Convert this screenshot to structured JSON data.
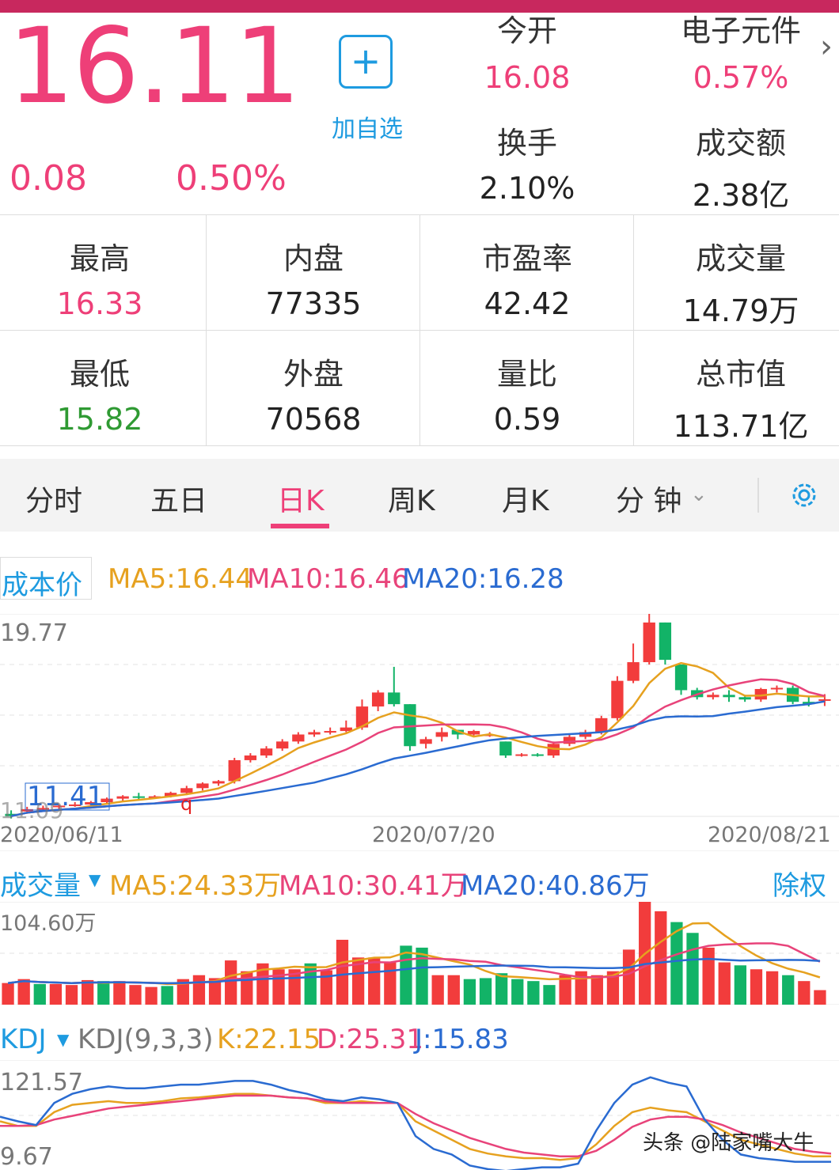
{
  "quote": {
    "price": "16.11",
    "change": "0.08",
    "change_pct": "0.50%",
    "add_label": "加自选",
    "add_icon": "plus-icon"
  },
  "top_stats": [
    {
      "label": "今开",
      "value": "16.08"
    },
    {
      "label": "电子元件",
      "value": "0.57%"
    },
    {
      "label": "换手",
      "value": "2.10%"
    },
    {
      "label": "成交额",
      "value": "2.38亿"
    }
  ],
  "stats_grid": [
    {
      "label": "最高",
      "value": "16.33"
    },
    {
      "label": "内盘",
      "value": "77335"
    },
    {
      "label": "市盈率",
      "value": "42.42"
    },
    {
      "label": "成交量",
      "value": "14.79万"
    },
    {
      "label": "最低",
      "value": "15.82"
    },
    {
      "label": "外盘",
      "value": "70568"
    },
    {
      "label": "量比",
      "value": "0.59"
    },
    {
      "label": "总市值",
      "value": "113.71亿"
    }
  ],
  "tabs": [
    "分时",
    "五日",
    "日K",
    "周K",
    "月K",
    "分 钟"
  ],
  "active_tab": "日K",
  "colors": {
    "up": "#f23c3c",
    "down": "#12b367",
    "ma5": "#e6a11f",
    "ma10": "#e8437a",
    "ma20": "#2a6bd1",
    "accent": "#ee3f78"
  },
  "kline": {
    "cost_btn": "成本价",
    "ma5": "MA5:16.44",
    "ma10": "MA10:16.46",
    "ma20": "MA20:16.28",
    "ymax_label": "19.77",
    "low_marker": "11.41",
    "low_marker_partial": "11.09",
    "q_marker": "q",
    "dates": [
      "2020/06/11",
      "2020/07/20",
      "2020/08/21"
    ]
  },
  "volume": {
    "title": "成交量",
    "ma5": "MA5:24.33万",
    "ma10": "MA10:30.41万",
    "ma20": "MA20:40.86万",
    "right_btn": "除权",
    "ymax_label": "104.60万"
  },
  "kdj": {
    "title": "KDJ",
    "params": "KDJ(9,3,3)",
    "k": "K:22.15",
    "d": "D:25.31",
    "j": "J:15.83",
    "ymax_label": "121.57",
    "ymin_label": "9.67"
  },
  "watermark": "头条 @陆家嘴大牛",
  "chart_data": [
    {
      "type": "candlestick",
      "title": "日K",
      "x": [
        "2020/06/11",
        "2020/07/20",
        "2020/08/21"
      ],
      "ohlc": [
        [
          11.2,
          11.35,
          11.1,
          11.0
        ],
        [
          11.3,
          11.5,
          11.4,
          11.2
        ],
        [
          11.4,
          11.55,
          11.45,
          11.3
        ],
        [
          11.5,
          11.6,
          11.55,
          11.4
        ],
        [
          11.55,
          11.7,
          11.6,
          11.5
        ],
        [
          11.6,
          11.75,
          11.7,
          11.5
        ],
        [
          11.7,
          11.9,
          11.85,
          11.6
        ],
        [
          11.85,
          12.0,
          11.95,
          11.75
        ],
        [
          11.95,
          12.1,
          11.9,
          11.8
        ],
        [
          11.9,
          12.0,
          11.95,
          11.85
        ],
        [
          11.95,
          12.15,
          12.1,
          11.9
        ],
        [
          12.1,
          12.4,
          12.3,
          12.0
        ],
        [
          12.3,
          12.55,
          12.5,
          12.2
        ],
        [
          12.5,
          12.65,
          12.6,
          12.4
        ],
        [
          12.6,
          13.6,
          13.5,
          12.5
        ],
        [
          13.5,
          13.8,
          13.7,
          13.4
        ],
        [
          13.7,
          14.1,
          14.0,
          13.6
        ],
        [
          14.0,
          14.4,
          14.3,
          13.9
        ],
        [
          14.3,
          14.7,
          14.6,
          14.2
        ],
        [
          14.6,
          14.8,
          14.7,
          14.5
        ],
        [
          14.7,
          14.9,
          14.75,
          14.6
        ],
        [
          14.75,
          15.2,
          14.9,
          14.7
        ],
        [
          14.9,
          16.1,
          15.8,
          14.8
        ],
        [
          15.8,
          16.5,
          16.4,
          15.6
        ],
        [
          16.4,
          17.5,
          15.9,
          15.8
        ],
        [
          15.9,
          15.0,
          14.1,
          13.9
        ],
        [
          14.2,
          14.5,
          14.4,
          14.0
        ],
        [
          14.5,
          14.9,
          14.7,
          14.3
        ],
        [
          14.8,
          14.5,
          14.6,
          14.4
        ],
        [
          14.6,
          14.8,
          14.75,
          14.5
        ],
        [
          14.6,
          14.7,
          14.6,
          14.5
        ],
        [
          14.3,
          14.2,
          13.7,
          13.6
        ],
        [
          13.7,
          13.8,
          13.75,
          13.65
        ],
        [
          13.75,
          13.8,
          13.7,
          13.65
        ],
        [
          13.7,
          14.3,
          14.2,
          13.6
        ],
        [
          14.2,
          14.6,
          14.5,
          14.1
        ],
        [
          14.5,
          14.8,
          14.7,
          14.4
        ],
        [
          14.7,
          15.4,
          15.3,
          14.6
        ],
        [
          15.3,
          17.1,
          16.9,
          15.2
        ],
        [
          16.9,
          18.5,
          17.7,
          16.8
        ],
        [
          17.7,
          19.77,
          19.4,
          17.6
        ],
        [
          19.4,
          18.9,
          17.8,
          17.6
        ],
        [
          17.6,
          17.2,
          16.5,
          16.3
        ],
        [
          16.5,
          16.6,
          16.2,
          16.1
        ],
        [
          16.2,
          16.4,
          16.3,
          16.1
        ],
        [
          16.3,
          16.5,
          16.2,
          16.0
        ],
        [
          16.2,
          16.3,
          16.1,
          16.0
        ],
        [
          16.1,
          16.6,
          16.55,
          16.0
        ],
        [
          16.55,
          16.7,
          16.6,
          16.4
        ],
        [
          16.6,
          16.7,
          16.0,
          15.9
        ],
        [
          16.0,
          16.2,
          15.9,
          15.8
        ],
        [
          16.08,
          16.33,
          16.11,
          15.82
        ]
      ],
      "ylim": [
        11.09,
        19.77
      ]
    },
    {
      "type": "bar",
      "title": "成交量",
      "values": [
        22,
        26,
        21,
        21,
        20,
        25,
        24,
        24,
        20,
        18,
        19,
        26,
        30,
        27,
        45,
        34,
        42,
        36,
        36,
        42,
        35,
        66,
        48,
        48,
        43,
        60,
        58,
        30,
        30,
        26,
        27,
        32,
        26,
        24,
        20,
        30,
        34,
        30,
        34,
        56,
        104.6,
        95,
        84,
        73,
        58,
        43,
        40,
        36,
        34,
        30,
        24,
        14.79
      ],
      "up": [
        1,
        1,
        0,
        1,
        1,
        1,
        0,
        1,
        1,
        1,
        0,
        1,
        1,
        1,
        1,
        1,
        1,
        1,
        1,
        0,
        1,
        1,
        1,
        1,
        1,
        0,
        0,
        1,
        1,
        0,
        0,
        0,
        0,
        0,
        0,
        1,
        1,
        1,
        1,
        1,
        1,
        1,
        0,
        0,
        1,
        1,
        0,
        1,
        1,
        0,
        1,
        1
      ],
      "ylim": [
        0,
        104.6
      ]
    },
    {
      "type": "line",
      "title": "KDJ(9,3,3)",
      "series": [
        {
          "name": "K",
          "values": [
            60,
            55,
            55,
            70,
            78,
            80,
            82,
            80,
            80,
            82,
            85,
            86,
            88,
            90,
            90,
            88,
            86,
            85,
            80,
            80,
            82,
            80,
            80,
            60,
            50,
            40,
            30,
            25,
            22,
            20,
            20,
            18,
            20,
            35,
            55,
            70,
            75,
            72,
            70,
            60,
            50,
            40,
            35,
            30,
            25,
            22,
            22
          ]
        },
        {
          "name": "D",
          "values": [
            55,
            55,
            56,
            62,
            66,
            70,
            74,
            76,
            78,
            80,
            82,
            84,
            86,
            88,
            88,
            88,
            86,
            85,
            82,
            80,
            80,
            80,
            80,
            68,
            58,
            50,
            42,
            36,
            30,
            26,
            24,
            22,
            22,
            28,
            40,
            54,
            62,
            65,
            65,
            62,
            56,
            48,
            42,
            36,
            30,
            27,
            25
          ]
        },
        {
          "name": "J",
          "values": [
            65,
            60,
            56,
            80,
            90,
            95,
            98,
            96,
            96,
            98,
            100,
            100,
            102,
            104,
            104,
            100,
            94,
            90,
            84,
            82,
            86,
            84,
            80,
            44,
            30,
            24,
            12,
            8,
            6,
            8,
            10,
            10,
            14,
            50,
            80,
            100,
            108,
            102,
            98,
            62,
            40,
            24,
            20,
            18,
            16,
            16,
            16
          ]
        }
      ],
      "ylim": [
        9.67,
        121.57
      ]
    }
  ]
}
